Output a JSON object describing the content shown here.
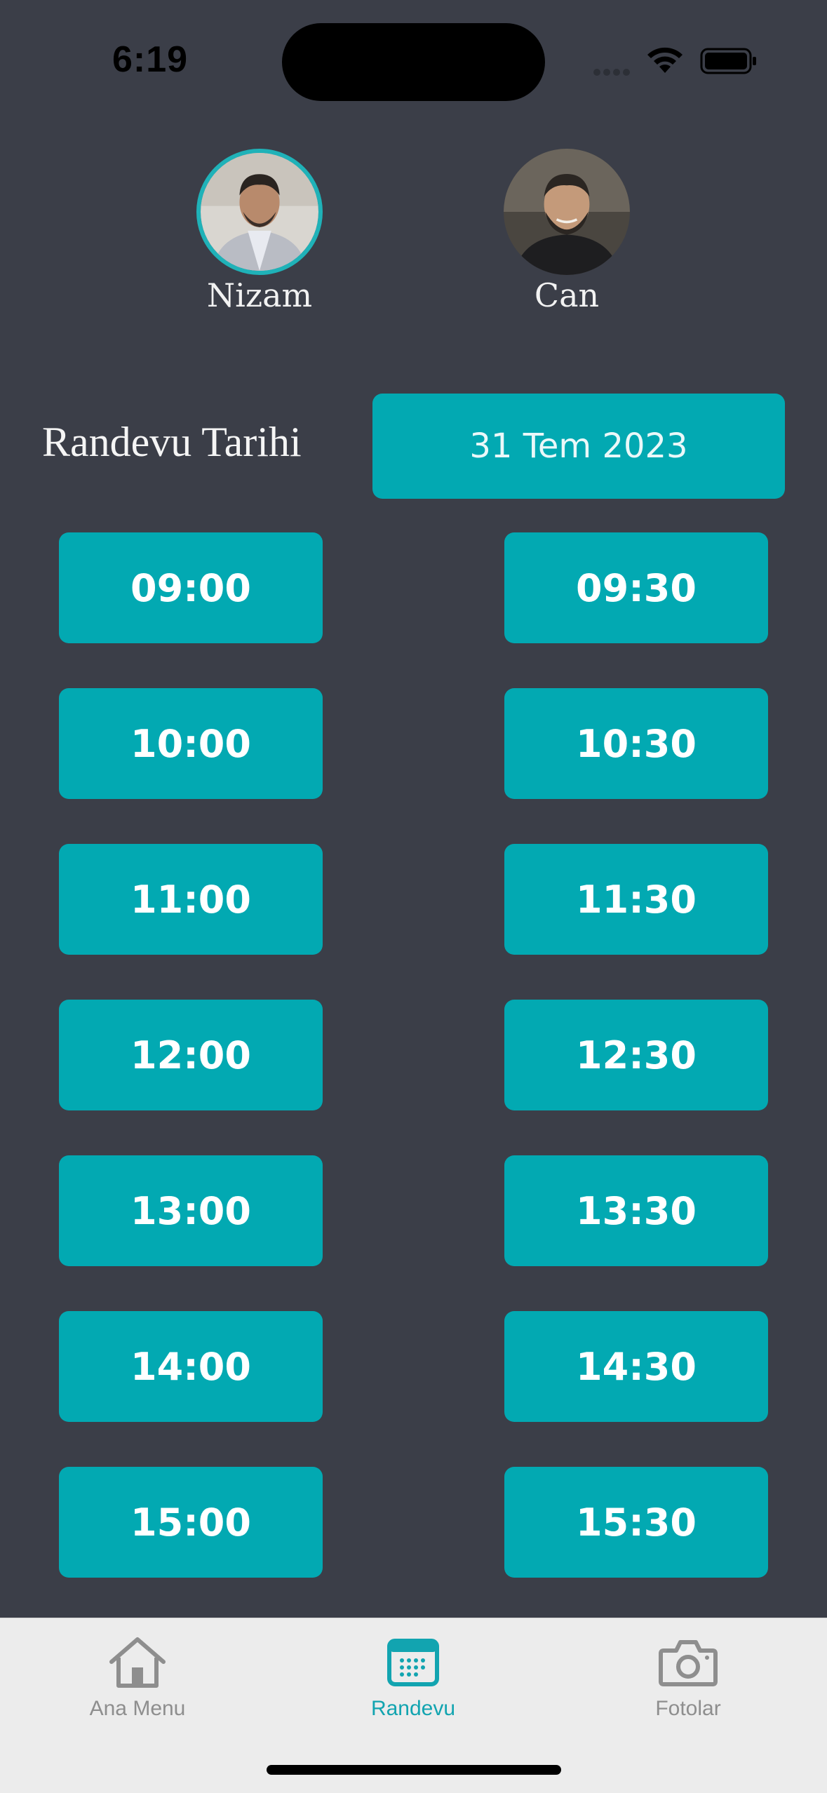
{
  "status_bar": {
    "time": "6:19"
  },
  "barbers": [
    {
      "name": "Nizam",
      "selected": true
    },
    {
      "name": "Can",
      "selected": false
    }
  ],
  "date_label": "Randevu Tarihi",
  "date_value": "31 Tem 2023",
  "slots": [
    "09:00",
    "09:30",
    "10:00",
    "10:30",
    "11:00",
    "11:30",
    "12:00",
    "12:30",
    "13:00",
    "13:30",
    "14:00",
    "14:30",
    "15:00",
    "15:30"
  ],
  "tabs": [
    {
      "label": "Ana Menu",
      "icon": "house-icon",
      "active": false
    },
    {
      "label": "Randevu",
      "icon": "calendar-icon",
      "active": true
    },
    {
      "label": "Fotolar",
      "icon": "camera-icon",
      "active": false
    }
  ],
  "colors": {
    "background": "#3b3e48",
    "accent": "#02a9b2",
    "tabbar": "#ececec",
    "tab_active": "#12a4b0",
    "tab_inactive": "#8e8e8e"
  }
}
